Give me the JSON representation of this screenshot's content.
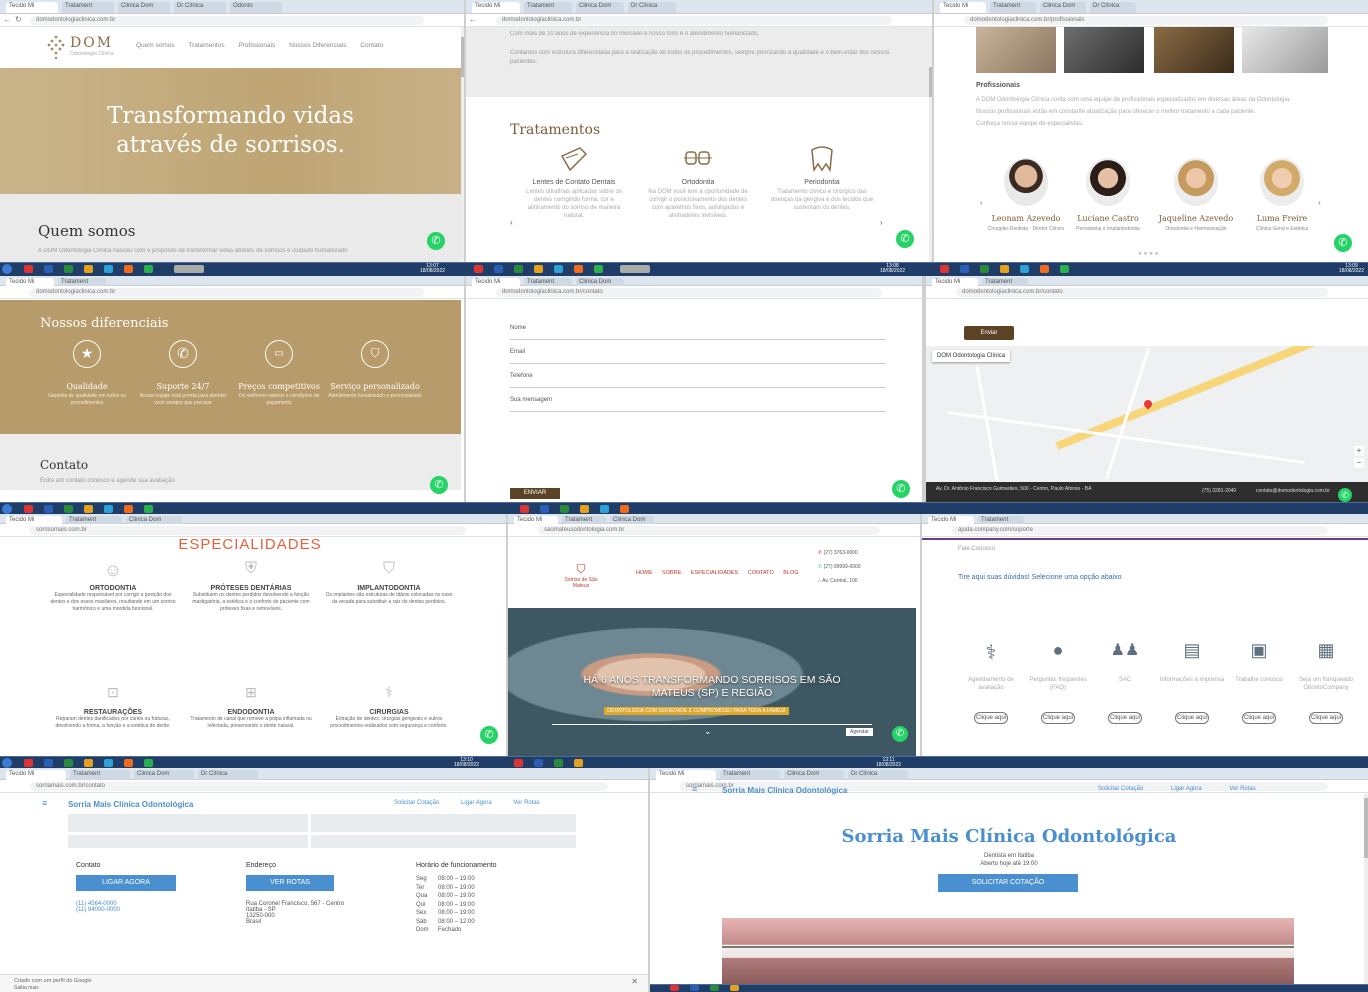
{
  "t1": {
    "tabs": [
      "Tecido Mi",
      "Tratament",
      "Clinica Dom",
      "Dr Clínica",
      "Odonto"
    ],
    "url": "domodontologiaclinica.com.br",
    "logo_text": "DOM",
    "logo_sub": "Odontologia Clínica",
    "nav": [
      "Quem somos",
      "Tratamentos",
      "Profissionais",
      "Nossos Diferenciais",
      "Contato"
    ],
    "hero_line1": "Transformando vidas",
    "hero_line2": "através de sorrisos.",
    "section_title": "Quem somos",
    "section_text": "A DOM Odontologia Clínica nasceu com o propósito de transformar vidas através de sorrisos e cuidado humanizado"
  },
  "t2": {
    "url": "domodontologiaclinica.com.br",
    "intro1": "Com mais de 10 anos de experiência no mercado e nosso foco é o atendimento humanizado,",
    "intro2": "Contamos com estrutura diferenciada para a realização de todos os procedimentos, sempre priorizando a qualidade e o bem-estar dos nossos pacientes.",
    "title": "Tratamentos",
    "items": [
      {
        "name": "Lentes de Contato Dentais",
        "desc": "Lentes ultrafinas aplicadas sobre os dentes corrigindo forma, cor e alinhamento do sorriso de maneira natural."
      },
      {
        "name": "Ortodontia",
        "desc": "Na DOM você tem a oportunidade de corrigir o posicionamento dos dentes com aparelhos fixos, autoligados e alinhadores invisíveis."
      },
      {
        "name": "Periodontia",
        "desc": "Tratamento clínico e cirúrgico das doenças da gengiva e dos tecidos que sustentam os dentes."
      }
    ]
  },
  "t3": {
    "url": "domodontologiaclinica.com.br/profissionais",
    "heading": "Profissionais",
    "p1": "A DOM Odontologia Clínica conta com uma equipe de profissionais especializados em diversas áreas da Odontologia.",
    "p2": "Nossos profissionais estão em constante atualização para oferecer o melhor tratamento a cada paciente.",
    "p3": "Conheça nossa equipe de especialistas.",
    "team": [
      {
        "name": "Leonam Azevedo",
        "role": "Cirurgião-Dentista · Diretor Clínico"
      },
      {
        "name": "Luciane Castro",
        "role": "Periodontia e Implantodontia"
      },
      {
        "name": "Jaqueline Azevedo",
        "role": "Ortodontia e Harmonização"
      },
      {
        "name": "Luma Freire",
        "role": "Clínica Geral e Estética"
      }
    ]
  },
  "t4": {
    "url": "domodontologiaclinica.com.br",
    "title": "Nossos diferenciais",
    "items": [
      {
        "icon": "star-icon",
        "name": "Qualidade",
        "desc": "Garantia de qualidade em todos os procedimentos"
      },
      {
        "icon": "phone-icon",
        "name": "Suporte 24/7",
        "desc": "Nossa equipe está pronta para atender você sempre que precisar"
      },
      {
        "icon": "money-icon",
        "name": "Preços competitivos",
        "desc": "Os melhores valores e condições de pagamento"
      },
      {
        "icon": "tooth-icon",
        "name": "Serviço personalizado",
        "desc": "Atendimento humanizado e personalizado"
      }
    ],
    "contact_title": "Contato",
    "contact_text": "Entre em contato conosco e agende sua avaliação",
    "clock_time": "13:07",
    "clock_date": "18/08/2022"
  },
  "t5": {
    "url": "domodontologiaclinica.com.br/contato",
    "fields": [
      "Nome",
      "Email",
      "Telefone",
      "Sua mensagem"
    ],
    "button": "ENVIAR",
    "clock_time": "13:08",
    "clock_date": "18/08/2022"
  },
  "t6": {
    "url": "domodontologiaclinica.com.br/contato",
    "button": "Enviar",
    "map_place": "DOM Odontologia Clínica",
    "footer_address": "Av. Dr. Antônio Francisco Guimarães, 500 - Centro, Paulo Afonso - BA",
    "footer_phone": "(75) 3281-2040",
    "footer_email": "contato@domodontologia.com.br",
    "clock_time": "13:09",
    "clock_date": "18/08/2022"
  },
  "t7": {
    "url": "sorrisomais.com.br",
    "title": "ESPECIALIDADES",
    "items": [
      {
        "icon": "smile-icon",
        "name": "ORTODONTIA",
        "desc": "Especialidade responsável por corrigir a posição dos dentes e dos ossos maxilares, resultando em um sorriso harmônico e uma mordida funcional."
      },
      {
        "icon": "shield-icon",
        "name": "PRÓTESES DENTÁRIAS",
        "desc": "Substituem os dentes perdidos devolvendo a função mastigatória, a estética e o conforto do paciente com próteses fixas e removíveis."
      },
      {
        "icon": "tooth-icon",
        "name": "IMPLANTODONTIA",
        "desc": "Os implantes são estruturas de titânio colocadas no osso da arcada para substituir a raiz de dentes perdidos."
      },
      {
        "icon": "restoration-icon",
        "name": "RESTAURAÇÕES",
        "desc": "Reparam dentes danificados por cáries ou fraturas, devolvendo a forma, a função e a estética do dente."
      },
      {
        "icon": "endodontia-icon",
        "name": "ENDODONTIA",
        "desc": "Tratamento de canal que remove a polpa inflamada ou infectada, preservando o dente natural."
      },
      {
        "icon": "surgery-icon",
        "name": "CIRURGIAS",
        "desc": "Extração de dentes, cirurgias gengivais e outros procedimentos realizados com segurança e conforto."
      }
    ],
    "clock_time": "13:10",
    "clock_date": "18/08/2022"
  },
  "t8": {
    "url": "saomateusodontologia.com.br",
    "logo": "Sorriso de São Mateus",
    "nav": [
      "HOME",
      "SOBRE",
      "ESPECIALIDADES",
      "CONTATO",
      "BLOG"
    ],
    "contacts": [
      "(27) 3763-0000",
      "(27) 99999-0000",
      "Av. Central, 100"
    ],
    "hero_line1": "HÁ 6 ANOS TRANSFORMANDO SORRISOS EM SÃO",
    "hero_line2": "MATEUS (SP) E REGIÃO",
    "hero_sub": "ODONTOLOGIA COM SERIEDADE E COMPROMISSO PARA TODA A FAMÍLIA",
    "cta": "Agendar",
    "clock_time": "13:11",
    "clock_date": "18/08/2022"
  },
  "t9": {
    "url": "ajuda.company.com/suporte",
    "brand": "Fale Conosco",
    "title": "Tire aqui suas dúvidas! Selecione uma opção abaixo",
    "options": [
      {
        "icon": "stethoscope-icon",
        "label": "Agendamento de avaliação"
      },
      {
        "icon": "chat-icon",
        "label": "Perguntas frequentes (FAQ)"
      },
      {
        "icon": "users-icon",
        "label": "SAC"
      },
      {
        "icon": "newspaper-icon",
        "label": "Informações à imprensa"
      },
      {
        "icon": "id-card-icon",
        "label": "Trabalhe conosco"
      },
      {
        "icon": "building-icon",
        "label": "Seja um franqueado OdontoCompany"
      }
    ],
    "button": "Clique aqui"
  },
  "t10": {
    "url": "sorriamais.com.br/contato",
    "brand": "Sorria Mais Clínica Odontológica",
    "nav": [
      "Solicitar Cotação",
      "Ligar Agora",
      "Ver Rotas"
    ],
    "contact_title": "Contato",
    "contact_btn": "LIGAR AGORA",
    "phones": [
      "(11) 4564-0000",
      "(11) 94000-0000"
    ],
    "address_title": "Endereço",
    "address_btn": "VER ROTAS",
    "address": [
      "Rua Coronel Francisco, 567 - Centro",
      "Itatiba - SP",
      "13250-000",
      "Brasil"
    ],
    "hours_title": "Horário de funcionamento",
    "hours": [
      [
        "Seg",
        "08:00 – 19:00"
      ],
      [
        "Ter",
        "08:00 – 19:00"
      ],
      [
        "Qua",
        "08:00 – 19:00"
      ],
      [
        "Qui",
        "08:00 – 19:00"
      ],
      [
        "Sex",
        "08:00 – 19:00"
      ],
      [
        "Sáb",
        "08:00 – 12:00"
      ],
      [
        "Dom",
        "Fechado"
      ]
    ],
    "footer_left": "Criado com um perfil do Google",
    "footer_mid": "Saiba mais"
  },
  "t11": {
    "url": "sorriamais.com.br",
    "brand": "Sorria Mais Clínica Odontológica",
    "nav": [
      "Solicitar Cotação",
      "Ligar Agora",
      "Ver Rotas"
    ],
    "hero_title": "Sorria Mais Clínica Odontológica",
    "hero_sub1": "Dentista em Itatiba",
    "hero_sub2": "Aberto hoje até 19:00",
    "cta": "SOLICITAR COTAÇÃO"
  }
}
